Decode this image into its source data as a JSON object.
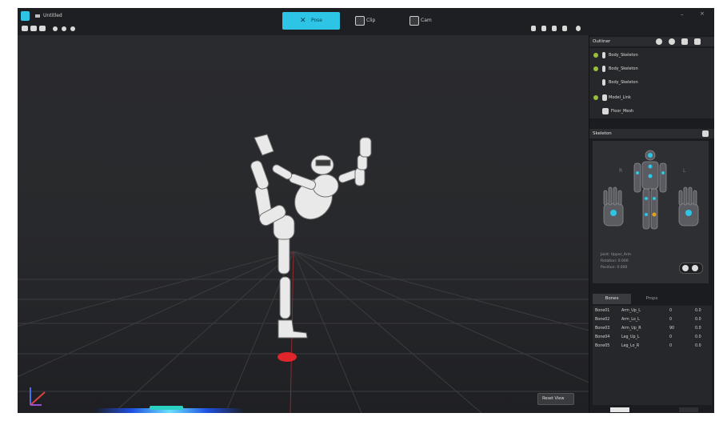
{
  "app": {
    "file_name": "Untitled"
  },
  "top_modes": [
    {
      "label": "Pose",
      "active": true
    },
    {
      "label": "Clip",
      "active": false
    },
    {
      "label": "Cam",
      "active": false
    }
  ],
  "hierarchy": {
    "title": "Outliner",
    "items": [
      {
        "label": "Body_Skeleton",
        "has_dot": true
      },
      {
        "label": "Body_Skeleton",
        "has_dot": true
      },
      {
        "label": "Body_Skeleton",
        "has_dot": false
      },
      {
        "label": "Model_Link",
        "has_dot": true
      },
      {
        "label": "Floor_Mesh",
        "has_dot": false
      }
    ]
  },
  "body_panel": {
    "title": "Skeleton",
    "left_label": "R",
    "right_label": "L",
    "info_lines": [
      "Joint: Upper_Arm",
      "Rotation: 0.000",
      "Position: 0.000"
    ]
  },
  "bottom_tabs": [
    {
      "label": "Bones",
      "active": true
    },
    {
      "label": "Props",
      "active": false
    }
  ],
  "bone_table": {
    "rows": [
      [
        "Bone01",
        "Arm_Up_L",
        "0",
        "0.0"
      ],
      [
        "Bone02",
        "Arm_Lo_L",
        "0",
        "0.0"
      ],
      [
        "Bone03",
        "Arm_Up_R",
        "90",
        "0.0"
      ],
      [
        "Bone04",
        "Leg_Up_L",
        "0",
        "0.0"
      ],
      [
        "Bone05",
        "Leg_Lo_R",
        "0",
        "0.0"
      ]
    ]
  },
  "reset_button": "Reset View",
  "colors": {
    "accent": "#2ec4e6",
    "marker": "#e0262b"
  },
  "icons": [
    "logo-icon",
    "menu-icon",
    "grid-icon",
    "layout-icon",
    "undo-icon",
    "redo-icon",
    "zoom-icon",
    "gear-icon",
    "eye-icon",
    "light-icon",
    "camera-icon",
    "lock-icon"
  ]
}
